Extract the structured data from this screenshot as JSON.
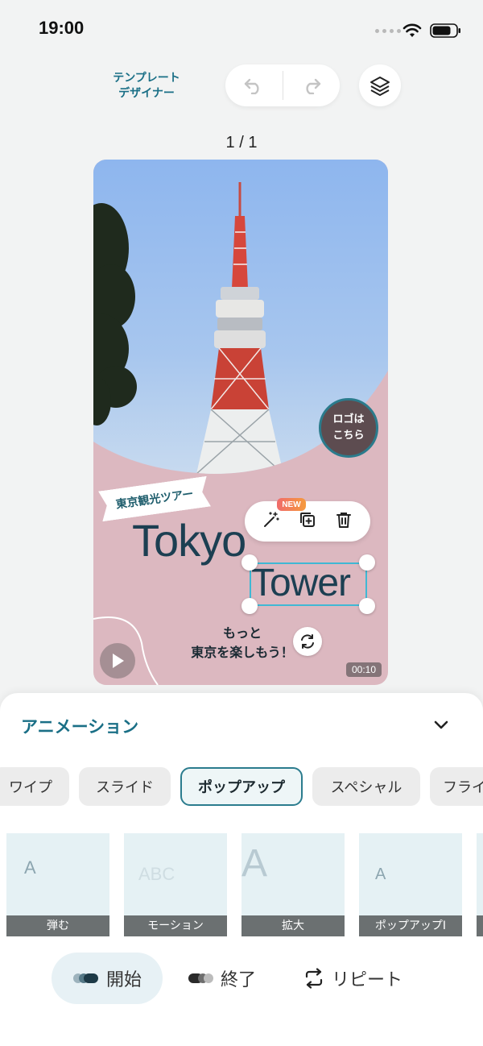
{
  "status": {
    "time": "19:00"
  },
  "header": {
    "title_line1": "テンプレート",
    "title_line2": "デザイナー"
  },
  "page_counter": "1 / 1",
  "canvas": {
    "logo_placeholder_line1": "ロゴは",
    "logo_placeholder_line2": "こちら",
    "ribbon_text": "東京観光ツアー",
    "title_word1": "Tokyo",
    "title_word2": "Tower",
    "subtitle_line1": "もっと",
    "subtitle_line2": "東京を楽しもう！",
    "duration": "00:10",
    "new_badge": "NEW"
  },
  "panel": {
    "title": "アニメーション",
    "categories": [
      "ワイプ",
      "スライド",
      "ポップアップ",
      "スペシャル",
      "フライ"
    ],
    "selected_category": "ポップアップ",
    "effects": [
      {
        "label": "弾む",
        "sample": "A"
      },
      {
        "label": "モーション",
        "sample": "ABC"
      },
      {
        "label": "拡大",
        "sample": "A"
      },
      {
        "label": "ポップアップI",
        "sample": "A"
      }
    ],
    "timing": {
      "start": "開始",
      "end": "終了",
      "repeat": "リピート"
    },
    "selected_timing": "開始"
  }
}
